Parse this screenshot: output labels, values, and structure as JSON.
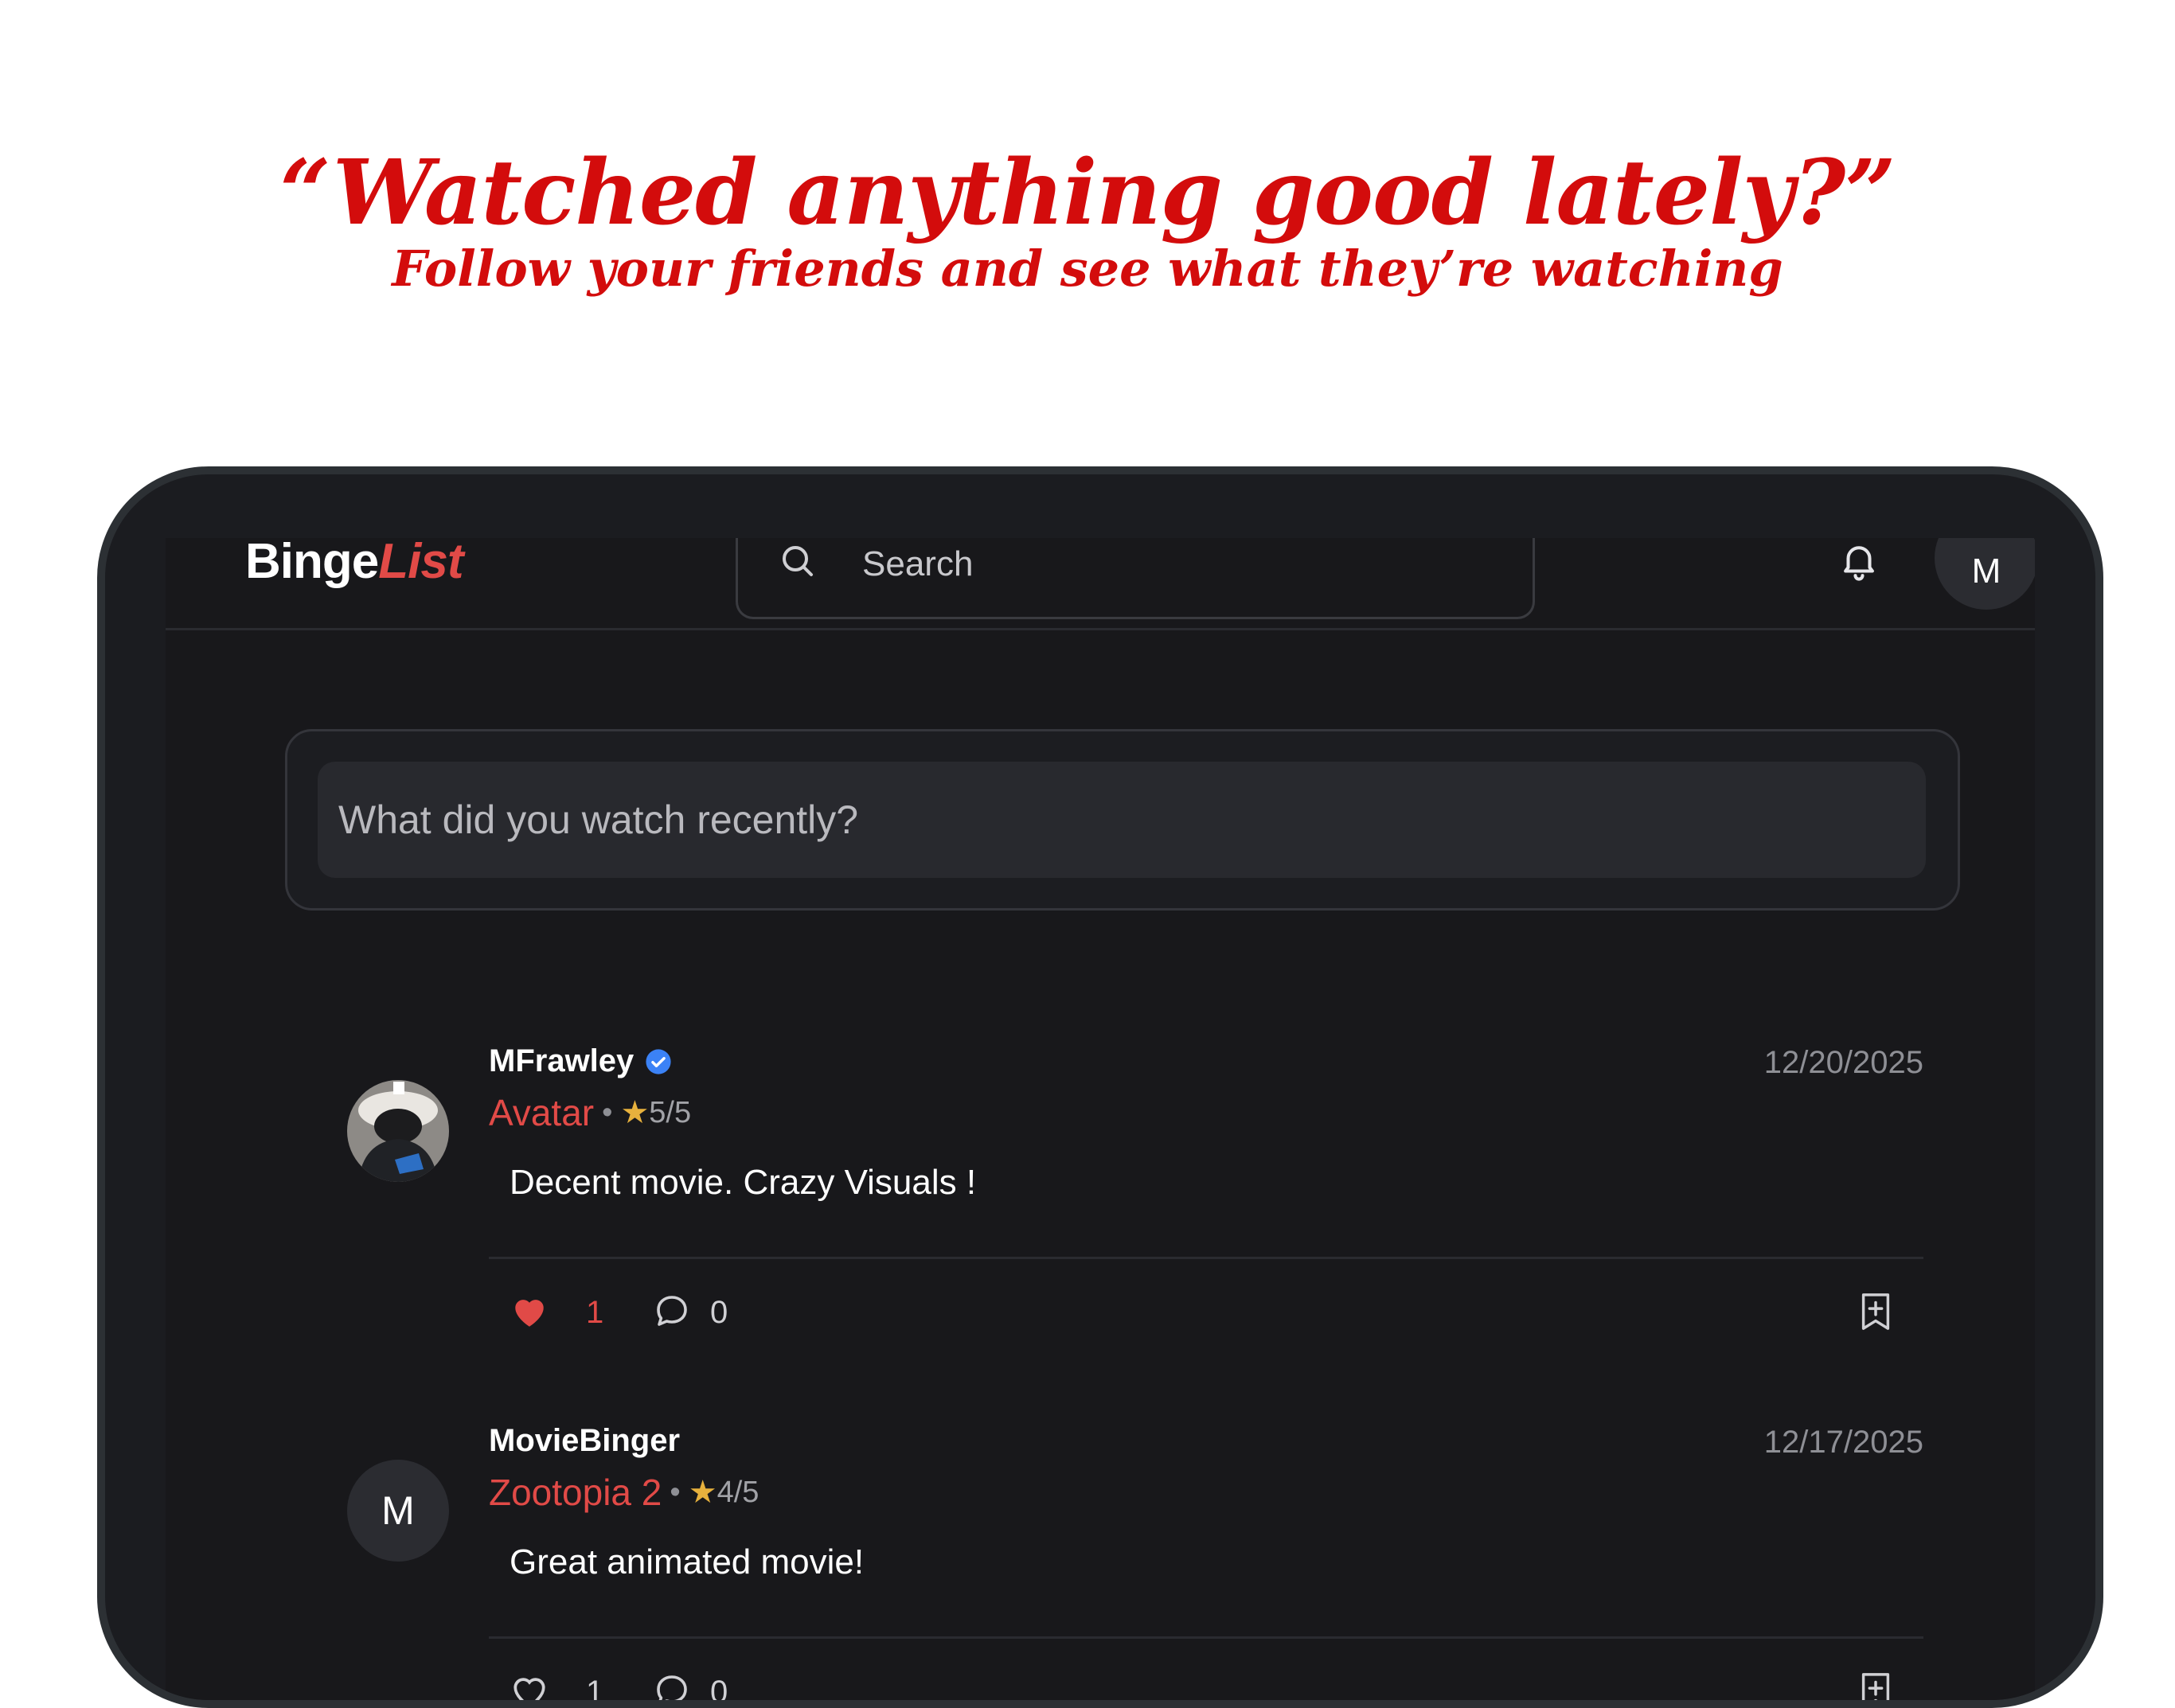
{
  "headline": {
    "title": "“Watched anything good lately?”",
    "subtitle": "Follow your friends and see what they’re watching"
  },
  "app": {
    "logo_main": "Binge",
    "logo_accent": "List",
    "search_label": "Search",
    "profile_initial": "M"
  },
  "composer": {
    "placeholder": "What did you watch recently?"
  },
  "colors": {
    "accent": "#e14a47",
    "headline": "#d30c0c",
    "background": "#18181b"
  },
  "posts": [
    {
      "username": "MFrawley",
      "verified": true,
      "date": "12/20/2025",
      "movie": "Avatar",
      "separator": "•",
      "star": "★",
      "rating": "5/5",
      "text": "Decent movie. Crazy Visuals !",
      "likes": "1",
      "comments": "0",
      "liked": true
    },
    {
      "username": "MovieBinger",
      "avatar_initial": "M",
      "verified": false,
      "date": "12/17/2025",
      "movie": "Zootopia 2",
      "separator": "•",
      "star": "★",
      "rating": "4/5",
      "text": "Great animated movie!",
      "likes": "1",
      "comments": "0",
      "liked": false
    }
  ]
}
